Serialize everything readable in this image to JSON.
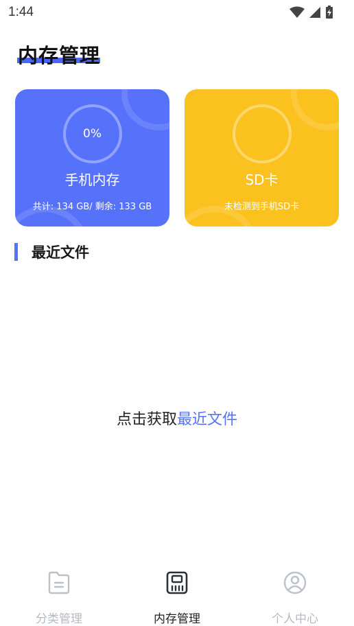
{
  "status_bar": {
    "time": "1:44",
    "icons": [
      "wifi-icon",
      "signal-icon",
      "battery-icon"
    ]
  },
  "page": {
    "title": "内存管理",
    "accent_color": "#4a67f7"
  },
  "cards": {
    "phone": {
      "percent": "0%",
      "name": "手机内存",
      "sub": "共计: 134 GB/ 剩余: 133 GB",
      "color": "#5672fb"
    },
    "sd": {
      "name": "SD卡",
      "sub": "未检测到手机SD卡",
      "color": "#fbc21f"
    }
  },
  "recent": {
    "title": "最近文件",
    "prompt_prefix": "点击获取",
    "prompt_link": "最近文件"
  },
  "bottom_nav": {
    "items": [
      {
        "label": "分类管理",
        "icon": "folder-icon",
        "active": false
      },
      {
        "label": "内存管理",
        "icon": "sd-card-icon",
        "active": true
      },
      {
        "label": "个人中心",
        "icon": "user-icon",
        "active": false
      }
    ]
  }
}
